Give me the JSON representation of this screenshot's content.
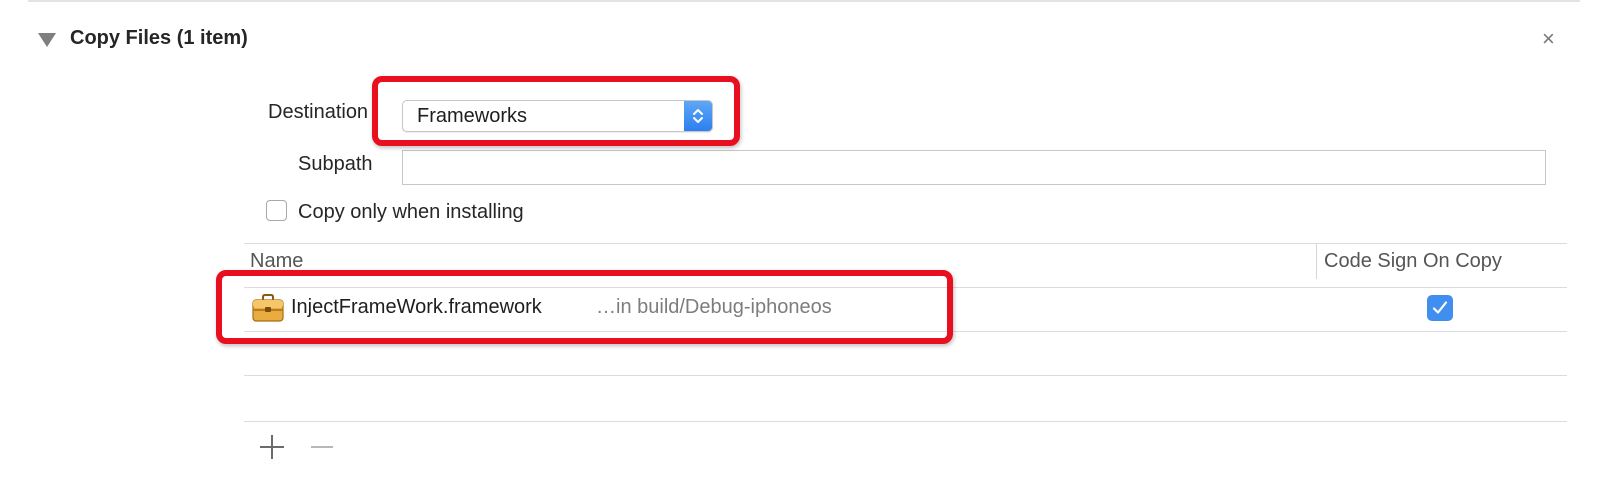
{
  "phase": {
    "title": "Copy Files (1 item)",
    "disclosure_icon": "disclosure-triangle-expanded",
    "close_symbol": "×"
  },
  "destination": {
    "label": "Destination",
    "value": "Frameworks",
    "icon": "popup-up-down-arrows"
  },
  "subpath": {
    "label": "Subpath",
    "value": "",
    "placeholder": ""
  },
  "copy_only": {
    "label": "Copy only when installing",
    "checked": false
  },
  "table": {
    "columns": [
      "Name",
      "Code Sign On Copy"
    ],
    "rows": [
      {
        "name": "InjectFrameWork.framework",
        "location": "…in build/Debug-iphoneos",
        "icon": "framework-toolbox-icon",
        "code_sign_on_copy": true
      }
    ]
  },
  "footer": {
    "add_icon": "plus-icon",
    "remove_icon": "minus-icon"
  },
  "colors": {
    "accent": "#3f8ef0",
    "annotation": "#e8101e"
  }
}
